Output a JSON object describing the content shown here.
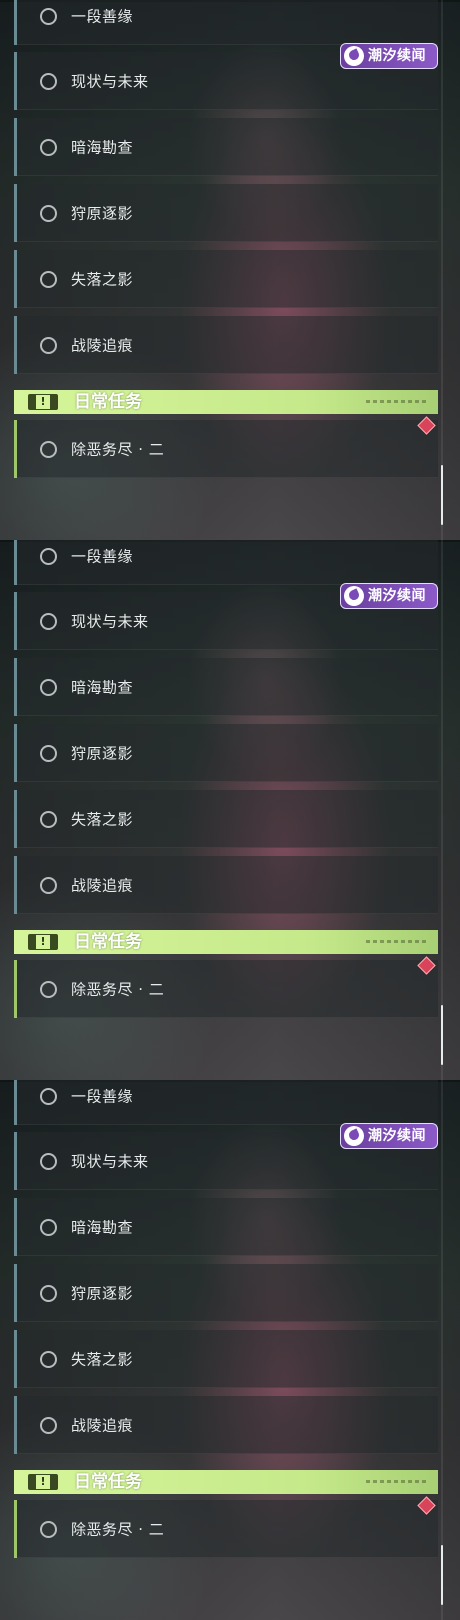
{
  "logo": {
    "text": "潮汐续闻"
  },
  "quests": [
    {
      "label": "一段善缘"
    },
    {
      "label": "现状与未来"
    },
    {
      "label": "暗海勘查"
    },
    {
      "label": "狩原逐影"
    },
    {
      "label": "失落之影"
    },
    {
      "label": "战陵追痕"
    }
  ],
  "daily": {
    "title": "日常任务",
    "icon": "exclamation-icon",
    "tasks": [
      {
        "label": "除恶务尽 · 二"
      }
    ]
  },
  "colors": {
    "accent": "#c5e98a",
    "logo": "#7a4ab7",
    "marker": "#d8455a"
  }
}
